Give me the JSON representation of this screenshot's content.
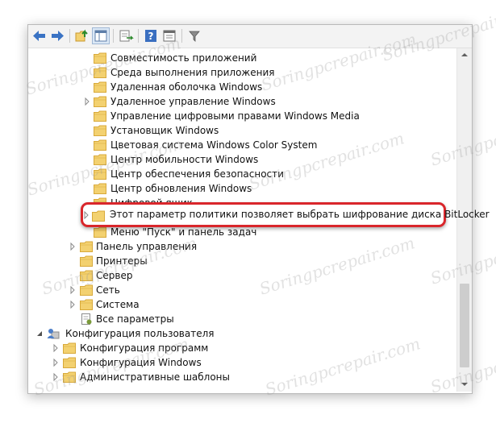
{
  "toolbar": {
    "buttons": [
      "back-icon",
      "forward-icon",
      "up-folder-icon",
      "show-tree-icon",
      "export-list-icon",
      "help-icon",
      "properties-icon",
      "filter-icon"
    ]
  },
  "tree": {
    "rows": [
      {
        "label": "Совместимость приложений",
        "icon": "folder"
      },
      {
        "label": "Среда выполнения приложения",
        "icon": "folder"
      },
      {
        "label": "Удаленная оболочка Windows",
        "icon": "folder"
      },
      {
        "label": "Удаленное управление Windows",
        "icon": "folder",
        "expander": "collapsed"
      },
      {
        "label": "Управление цифровыми правами Windows Media",
        "icon": "folder"
      },
      {
        "label": "Установщик Windows",
        "icon": "folder"
      },
      {
        "label": "Цветовая система Windows Color System",
        "icon": "folder"
      },
      {
        "label": "Центр мобильности Windows",
        "icon": "folder"
      },
      {
        "label": "Центр обеспечения безопасности",
        "icon": "folder"
      },
      {
        "label": "Центр обновления Windows",
        "icon": "folder"
      },
      {
        "label": "Цифровой ящик",
        "icon": "folder"
      },
      {
        "label": "Шифрование диска BitLocker",
        "icon": "folder",
        "expander": "collapsed"
      },
      {
        "label": "Меню \"Пуск\" и панель задач",
        "icon": "folder"
      },
      {
        "label": "Панель управления",
        "icon": "folder",
        "expander": "collapsed"
      },
      {
        "label": "Принтеры",
        "icon": "folder"
      },
      {
        "label": "Сервер",
        "icon": "folder"
      },
      {
        "label": "Сеть",
        "icon": "folder",
        "expander": "collapsed"
      },
      {
        "label": "Система",
        "icon": "folder",
        "expander": "collapsed"
      },
      {
        "label": "Все параметры",
        "icon": "settings-page"
      },
      {
        "label": "Конфигурация пользователя",
        "icon": "user",
        "expander": "expanded"
      },
      {
        "label": "Конфигурация программ",
        "icon": "folder",
        "expander": "collapsed"
      },
      {
        "label": "Конфигурация Windows",
        "icon": "folder",
        "expander": "collapsed"
      },
      {
        "label": "Административные шаблоны",
        "icon": "folder",
        "expander": "collapsed"
      }
    ]
  },
  "callout": {
    "label": "Этот параметр политики позволяет выбрать шифрование диска BitLocker",
    "border_color": "#d9262b"
  },
  "watermark": "Soringpcrepair.com",
  "colors": {
    "folder": "#f3d170",
    "folder_dark": "#d8a93a",
    "arrow_blue": "#3a73c4",
    "highlight": "#d9262b"
  }
}
